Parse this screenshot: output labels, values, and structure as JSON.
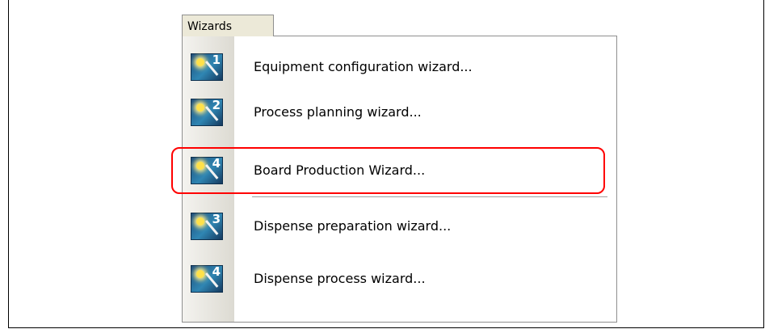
{
  "tab": {
    "label": "Wizards"
  },
  "items": [
    {
      "number": "1",
      "label": "Equipment configuration wizard..."
    },
    {
      "number": "2",
      "label": "Process planning wizard..."
    },
    {
      "number": "4",
      "label": "Board Production Wizard..."
    },
    {
      "number": "3",
      "label": "Dispense preparation wizard..."
    },
    {
      "number": "4",
      "label": "Dispense process wizard..."
    }
  ],
  "highlight": {
    "color": "#ff0000",
    "item_index": 2
  },
  "icon_name": "magic-wand-icon"
}
